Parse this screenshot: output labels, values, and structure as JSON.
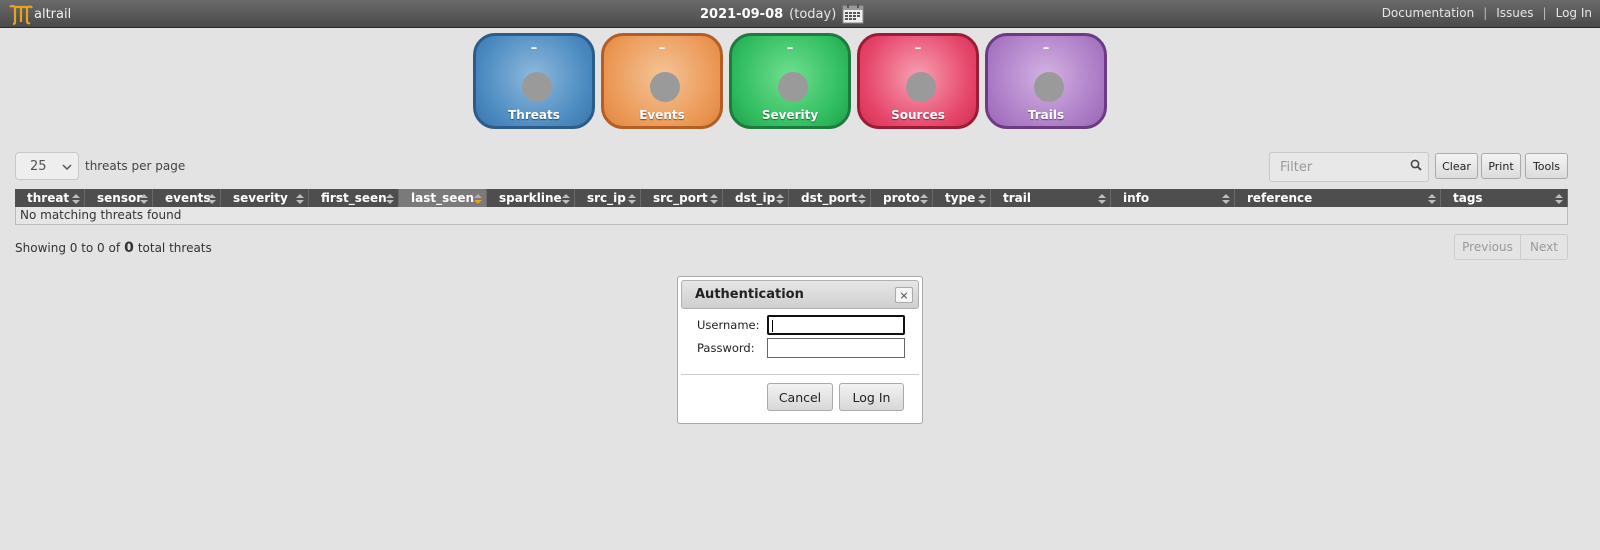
{
  "header": {
    "logo_text": "altrail",
    "logo_icon": "maltrail-logo-icon",
    "date": "2021-09-08",
    "date_suffix": "(today)",
    "calendar_icon": "calendar-icon",
    "links": [
      "Documentation",
      "Issues",
      "Log In"
    ],
    "separator": "|"
  },
  "tiles": [
    {
      "label": "Threats",
      "value": "–"
    },
    {
      "label": "Events",
      "value": "–"
    },
    {
      "label": "Severity",
      "value": "–"
    },
    {
      "label": "Sources",
      "value": "–"
    },
    {
      "label": "Trails",
      "value": "–"
    }
  ],
  "controls": {
    "per_page_value": "25",
    "per_page_label": "threats per page",
    "filter_placeholder": "Filter",
    "buttons": [
      "Clear",
      "Print",
      "Tools"
    ]
  },
  "table": {
    "columns": [
      "threat",
      "sensor",
      "events",
      "severity",
      "first_seen",
      "last_seen",
      "sparkline",
      "src_ip",
      "src_port",
      "dst_ip",
      "dst_port",
      "proto",
      "type",
      "trail",
      "info",
      "reference",
      "tags"
    ],
    "sorted_column": "last_seen",
    "empty_message": "No matching threats found"
  },
  "footer": {
    "showing_prefix": "Showing 0 to 0 of",
    "total": "0",
    "showing_suffix": "total threats",
    "previous": "Previous",
    "next": "Next"
  },
  "dialog": {
    "title": "Authentication",
    "close": "×",
    "username_label": "Username:",
    "password_label": "Password:",
    "username_value": "",
    "password_value": "",
    "cancel": "Cancel",
    "login": "Log In"
  },
  "colors": {
    "threats": "#4a8ac0",
    "events": "#ec9855",
    "severity": "#2fbc5e",
    "sources": "#e6456a",
    "trails": "#ac7cc6"
  }
}
